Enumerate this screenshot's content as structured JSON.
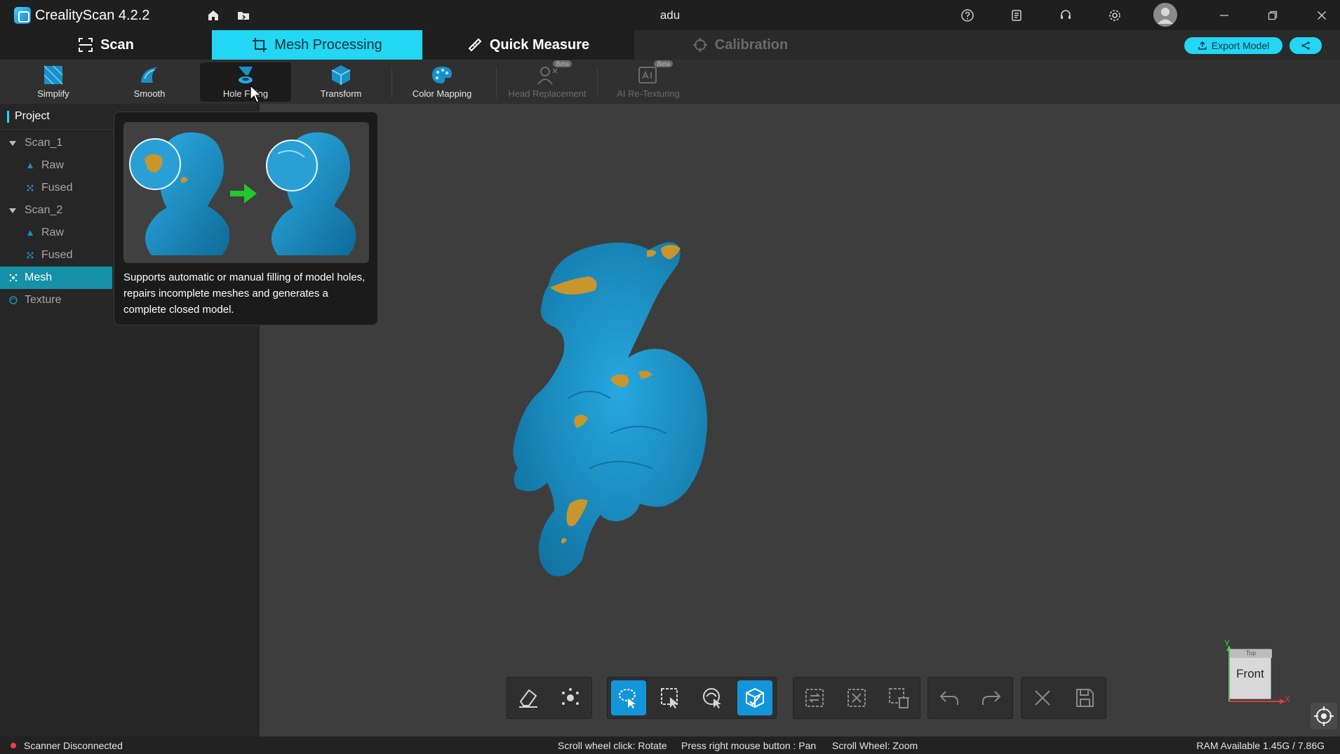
{
  "app": {
    "title": "CrealityScan 4.2.2",
    "project_name": "adu"
  },
  "modes": [
    {
      "label": "Scan",
      "state": "normal"
    },
    {
      "label": "Mesh Processing",
      "state": "active"
    },
    {
      "label": "Quick Measure",
      "state": "normal"
    },
    {
      "label": "Calibration",
      "state": "disabled"
    }
  ],
  "header_actions": {
    "export_label": "Export Model"
  },
  "tools": [
    {
      "label": "Simplify",
      "icon": "simplify-icon"
    },
    {
      "label": "Smooth",
      "icon": "smooth-icon"
    },
    {
      "label": "Hole Filling",
      "icon": "hole-filling-icon"
    },
    {
      "label": "Transform",
      "icon": "transform-icon"
    },
    {
      "label": "Color Mapping",
      "icon": "color-mapping-icon"
    },
    {
      "label": "Head Replacement",
      "icon": "head-replacement-icon",
      "badge": "Beta"
    },
    {
      "label": "AI Re-Texturing",
      "icon": "ai-retexturing-icon",
      "badge": "Beta"
    }
  ],
  "project_panel": {
    "title": "Project",
    "tree": [
      {
        "label": "Scan_1",
        "type": "group"
      },
      {
        "label": "Raw",
        "type": "leaf"
      },
      {
        "label": "Fused",
        "type": "leaf"
      },
      {
        "label": "Scan_2",
        "type": "group"
      },
      {
        "label": "Raw",
        "type": "leaf"
      },
      {
        "label": "Fused",
        "type": "leaf"
      },
      {
        "label": "Mesh",
        "type": "root",
        "selected": true
      },
      {
        "label": "Texture",
        "type": "root"
      }
    ]
  },
  "tooltip": {
    "description": "Supports automatic or manual filling of model holes, repairs incomplete meshes and generates a complete closed model."
  },
  "viewcube": {
    "face": "Front",
    "top_face": "Top",
    "axis_x": "X",
    "axis_y": "Y"
  },
  "status": {
    "scanner": "Scanner Disconnected",
    "hint_rotate": "Scroll wheel click: Rotate",
    "hint_pan": "Press right mouse button : Pan",
    "hint_zoom": "Scroll Wheel: Zoom",
    "ram": "RAM Available 1.45G / 7.86G"
  },
  "colors": {
    "accent": "#22d6f4",
    "model_blue": "#1591c6",
    "hole_orange": "#c8962c",
    "selected_row": "#1590a7"
  }
}
